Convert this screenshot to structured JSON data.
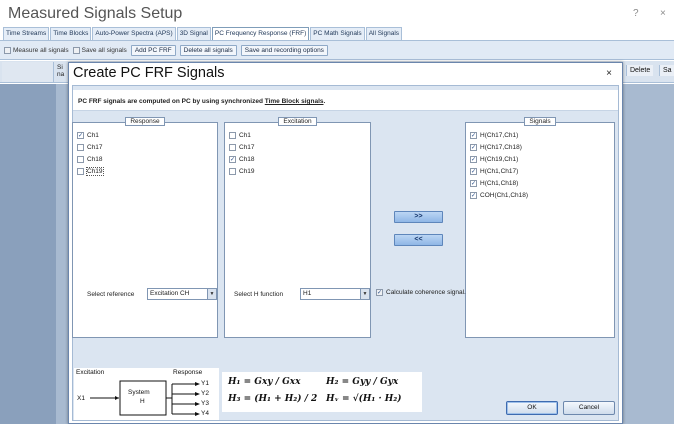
{
  "app": {
    "title": "Measured Signals Setup",
    "help_glyph": "?",
    "close_glyph": "×"
  },
  "tabs": [
    {
      "label": "Time Streams",
      "active": false
    },
    {
      "label": "Time Blocks",
      "active": false
    },
    {
      "label": "Auto-Power Spectra (APS)",
      "active": false
    },
    {
      "label": "3D Signal",
      "active": false
    },
    {
      "label": "PC Frequency Response (FRF)",
      "active": true
    },
    {
      "label": "PC Math Signals",
      "active": false
    },
    {
      "label": "All Signals",
      "active": false
    }
  ],
  "toolbar": {
    "measure_all_label": "Measure all signals",
    "save_all_label": "Save all signals",
    "add_pc_frf_label": "Add PC FRF",
    "delete_all_label": "Delete all signals",
    "save_recording_label": "Save and recording options"
  },
  "grid": {
    "si_line1": "Si",
    "si_line2": "na",
    "delete_label": "Delete",
    "sa_label": "Sa"
  },
  "dialog": {
    "title": "Create PC FRF Signals",
    "close_glyph": "×",
    "description_prefix": "PC FRF signals are computed on PC by using synchronized ",
    "description_link": "Time Block signals",
    "description_suffix": ".",
    "response": {
      "title": "Response",
      "items": [
        {
          "label": "Ch1",
          "checked": true
        },
        {
          "label": "Ch17",
          "checked": false
        },
        {
          "label": "Ch18",
          "checked": false
        },
        {
          "label": "Ch19",
          "checked": false
        }
      ]
    },
    "excitation": {
      "title": "Excitation",
      "items": [
        {
          "label": "Ch1",
          "checked": false
        },
        {
          "label": "Ch17",
          "checked": false
        },
        {
          "label": "Ch18",
          "checked": true
        },
        {
          "label": "Ch19",
          "checked": false
        }
      ]
    },
    "signals": {
      "title": "Signals",
      "items": [
        {
          "label": "H(Ch17,Ch1)",
          "checked": true
        },
        {
          "label": "H(Ch17,Ch18)",
          "checked": true
        },
        {
          "label": "H(Ch19,Ch1)",
          "checked": true
        },
        {
          "label": "H(Ch1,Ch17)",
          "checked": true
        },
        {
          "label": "H(Ch1,Ch18)",
          "checked": true
        },
        {
          "label": "COH(Ch1,Ch18)",
          "checked": true
        }
      ]
    },
    "add_button": ">>",
    "remove_button": "<<",
    "select_reference_label": "Select reference",
    "select_reference_value": "Excitation CH",
    "select_h_label": "Select H function",
    "select_h_value": "H1",
    "coherence_label": "Calculate coherence signal.",
    "coherence_checked": true,
    "diagram": {
      "excitation": "Excitation",
      "response": "Response",
      "input": "X1",
      "system_line1": "System",
      "system_line2": "H",
      "outputs": [
        "Y1",
        "Y2",
        "Y3",
        "Y4"
      ]
    },
    "formulas": {
      "h1": "H₁ = Gxy / Gxx",
      "h2": "H₂ = Gyy / Gyx",
      "h3": "H₃ = (H₁ + H₂) / 2",
      "hv": "Hᵥ = √(H₁ · H₂)"
    },
    "ok_label": "OK",
    "cancel_label": "Cancel"
  },
  "colors": {
    "accent": "#2a4f8a",
    "dialog_bg": "#dbe5f1",
    "grid_bg": "#a8bad0"
  }
}
